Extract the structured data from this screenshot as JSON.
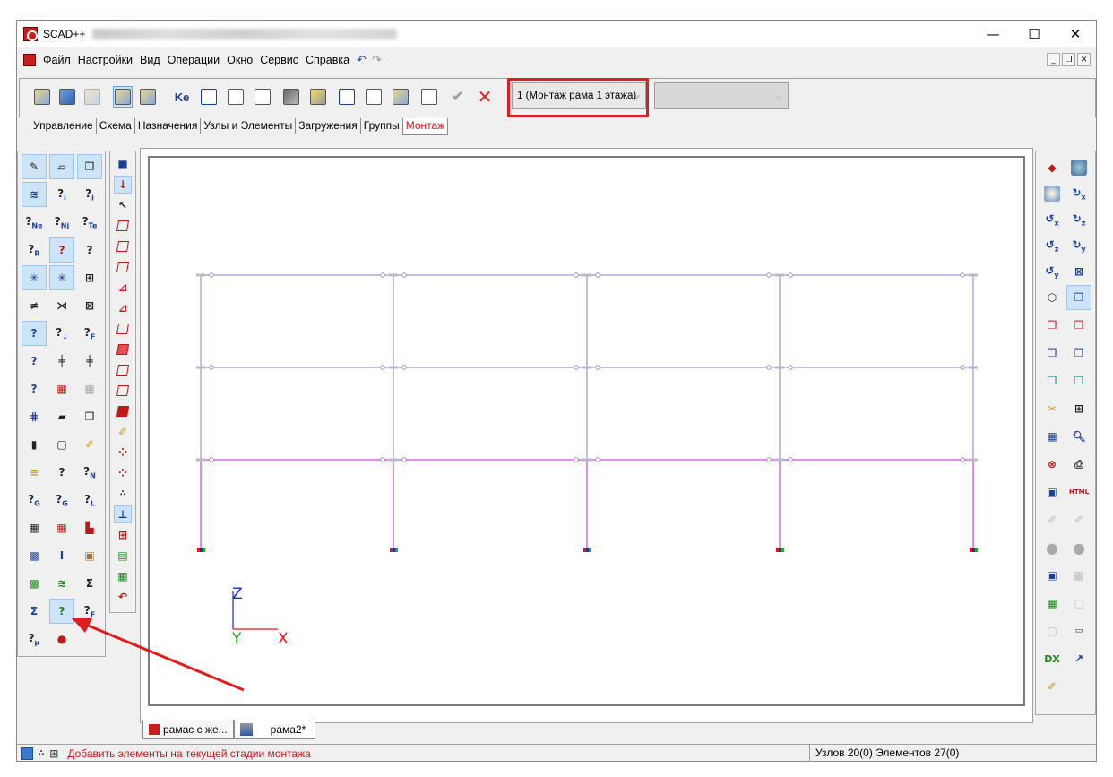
{
  "app": {
    "title": "SCAD++"
  },
  "window_controls": {
    "minimize": "—",
    "maximize": "☐",
    "close": "✕"
  },
  "menu": {
    "items": [
      "Файл",
      "Настройки",
      "Вид",
      "Операции",
      "Окно",
      "Сервис",
      "Справка"
    ]
  },
  "toolbar": {
    "combo_stage": "1 (Монтаж рама 1 этажа)",
    "combo_second": "",
    "ke_label": "Ke"
  },
  "tabs": [
    "Управление",
    "Схема",
    "Назначения",
    "Узлы и Элементы",
    "Загружения",
    "Группы",
    "Монтаж"
  ],
  "active_tab": "Монтаж",
  "documents": [
    "рамас с же...",
    "рама2*"
  ],
  "axes": {
    "z": "Z",
    "y": "Y",
    "x": "X"
  },
  "right_panel": {
    "dx_label": "DX",
    "html_label": "HTML"
  },
  "status": {
    "message": "Добавить элементы на текущей стадии монтажа",
    "counts": "Узлов 20(0) Элементов 27(0)"
  },
  "colors": {
    "accent_red": "#e01c1c",
    "frame_purple": "#8a7ccc",
    "frame_magenta": "#c020c8",
    "axis_z": "#1a2ad0",
    "axis_y": "#18b018",
    "axis_x": "#e01818"
  }
}
